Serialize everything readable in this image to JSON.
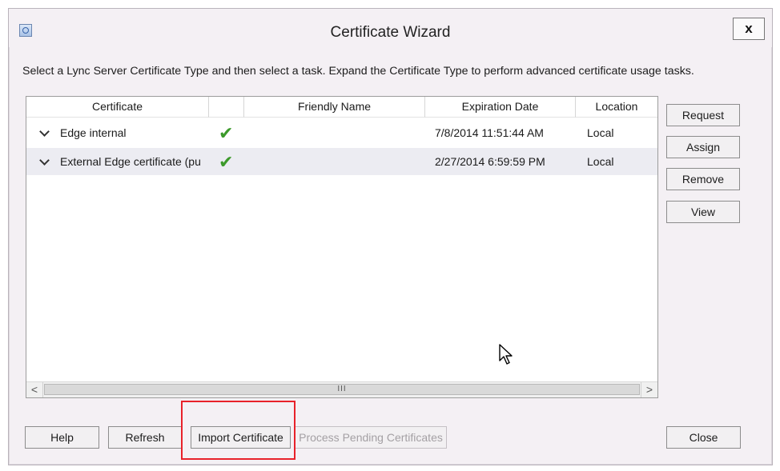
{
  "window": {
    "title": "Certificate Wizard",
    "close_label": "x",
    "instructions": "Select a Lync Server Certificate Type and then select a task. Expand the Certificate Type to perform advanced certificate usage tasks."
  },
  "table": {
    "columns": [
      "Certificate",
      "",
      "Friendly Name",
      "Expiration Date",
      "Location"
    ],
    "rows": [
      {
        "certificate": "Edge internal",
        "status": "check-icon",
        "friendly_name": "",
        "expiration": "7/8/2014 11:51:44 AM",
        "location": "Local"
      },
      {
        "certificate": "External Edge certificate (pu",
        "status": "check-icon",
        "friendly_name": "",
        "expiration": "2/27/2014 6:59:59 PM",
        "location": "Local"
      }
    ],
    "scrollbar": {
      "left": "<",
      "right": ">",
      "thumb": "III"
    }
  },
  "side_buttons": {
    "request": "Request",
    "assign": "Assign",
    "remove": "Remove",
    "view": "View"
  },
  "bottom_buttons": {
    "help": "Help",
    "refresh": "Refresh",
    "import": "Import Certificate",
    "process": "Process Pending Certificates",
    "close": "Close"
  },
  "colors": {
    "highlight": "#e8212a",
    "check": "#3c9a2b"
  }
}
